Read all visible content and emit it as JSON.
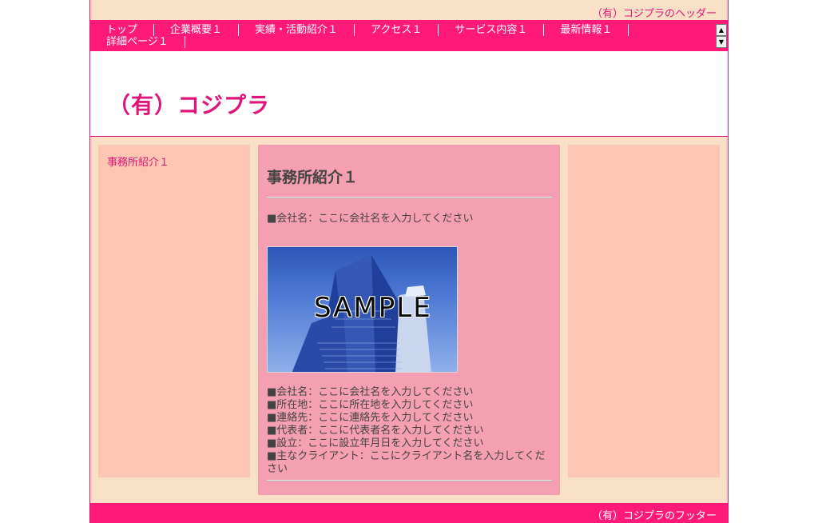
{
  "header": {
    "text": "（有）コジプラのヘッダー"
  },
  "nav": {
    "items": [
      "トップ",
      "企業概要１",
      "実績・活動紹介１",
      "アクセス１",
      "サービス内容１",
      "最新情報１",
      "詳細ページ１"
    ],
    "scroll_up": "▲",
    "scroll_down": "▼"
  },
  "hero": {
    "site_title": "（有）コジプラ"
  },
  "sidebar": {
    "items": [
      "事務所紹介１"
    ]
  },
  "main": {
    "title": "事務所紹介１",
    "intro": "■会社名：ここに会社名を入力してください",
    "image_label": "SAMPLE",
    "details": [
      "■会社名：ここに会社名を入力してください",
      "■所在地：ここに所在地を入力してください",
      "■連絡先：ここに連絡先を入力してください",
      "■代表者：ここに代表者名を入力してください",
      "■設立：ここに設立年月日を入力してください",
      "■主なクライアント：ここにクライアント名を入力してください"
    ]
  },
  "footer": {
    "text": "（有）コジプラのフッター"
  },
  "colors": {
    "accent": "#ff1a7a",
    "page_bg": "#f7e0c6",
    "side_bg": "#fdc6b2",
    "main_bg": "#f49fb2"
  }
}
